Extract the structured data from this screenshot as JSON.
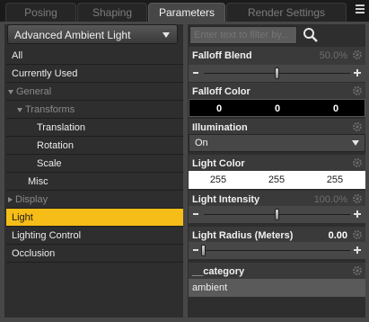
{
  "tabs": [
    {
      "label": "Posing"
    },
    {
      "label": "Shaping"
    },
    {
      "label": "Parameters"
    },
    {
      "label": "Render Settings"
    }
  ],
  "node_selector": {
    "value": "Advanced Ambient Light"
  },
  "tree": {
    "items": [
      {
        "label": "All"
      },
      {
        "label": "Currently Used"
      },
      {
        "label": "General"
      },
      {
        "label": "Transforms"
      },
      {
        "label": "Translation"
      },
      {
        "label": "Rotation"
      },
      {
        "label": "Scale"
      },
      {
        "label": "Misc"
      },
      {
        "label": "Display"
      },
      {
        "label": "Light"
      },
      {
        "label": "Lighting Control"
      },
      {
        "label": "Occlusion"
      }
    ]
  },
  "filter": {
    "placeholder": "Enter text to filter by..."
  },
  "params": {
    "falloff_blend": {
      "label": "Falloff Blend",
      "value": "50.0%",
      "level": 0.5
    },
    "falloff_color": {
      "label": "Falloff Color",
      "r": "0",
      "g": "0",
      "b": "0"
    },
    "illumination": {
      "label": "Illumination",
      "value": "On"
    },
    "light_color": {
      "label": "Light Color",
      "r": "255",
      "g": "255",
      "b": "255"
    },
    "light_intensity": {
      "label": "Light Intensity",
      "value": "100.0%",
      "level": 0.5
    },
    "light_radius": {
      "label": "Light Radius (Meters)",
      "value": "0.00",
      "level": 0.0
    },
    "category": {
      "label": "__category",
      "value": "ambient"
    }
  },
  "colors": {
    "selection": "#f6bd18",
    "panel": "#2e2e2e",
    "background": "#474747"
  }
}
